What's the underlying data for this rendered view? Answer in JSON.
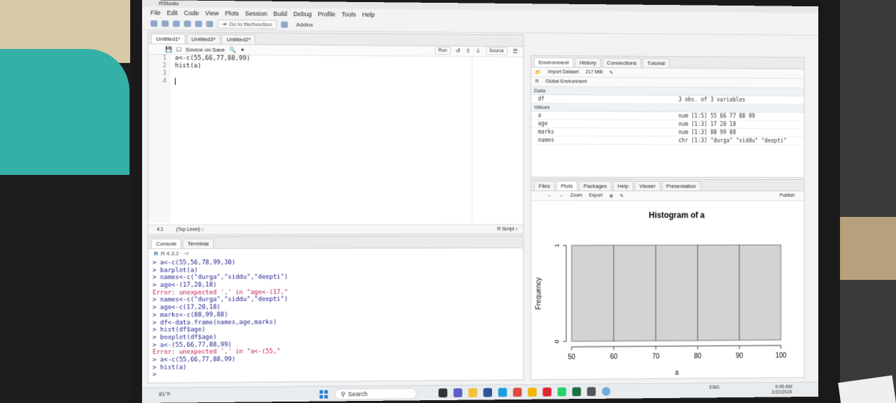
{
  "app": {
    "title": "RStudio"
  },
  "menu": [
    "File",
    "Edit",
    "Code",
    "View",
    "Plots",
    "Session",
    "Build",
    "Debug",
    "Profile",
    "Tools",
    "Help"
  ],
  "toolbar": {
    "goto_label": "Go to file/function",
    "addins_label": "Addins"
  },
  "source": {
    "tabs": [
      "Untitled1*",
      "Untitled3*",
      "Untitled2*"
    ],
    "source_on_save": "Source on Save",
    "run_label": "Run",
    "source_label": "Source",
    "lines": [
      {
        "n": "1",
        "text": "a<-c(55,66,77,88,99)"
      },
      {
        "n": "2",
        "text": "hist(a)"
      },
      {
        "n": "3",
        "text": ""
      },
      {
        "n": "4",
        "text": ""
      }
    ],
    "status_pos": "4:1",
    "status_scope": "(Top Level) ↕",
    "status_type": "R Script ↕"
  },
  "console": {
    "tabs": [
      "Console",
      "Terminal"
    ],
    "version": "R 4.3.2 · ~/",
    "lines": [
      {
        "text": "> a<-c(55,56,78,99,30)",
        "err": false
      },
      {
        "text": "> barplot(a)",
        "err": false
      },
      {
        "text": "> names<-c(\"durga\",\"siddu\",\"deepti\")",
        "err": false
      },
      {
        "text": "> age<-(17,20,18)",
        "err": false
      },
      {
        "text": "Error: unexpected ',' in \"age<-(17,\"",
        "err": true
      },
      {
        "text": "> names<-c(\"durga\",\"siddu\",\"deepti\")",
        "err": false
      },
      {
        "text": "> age<-c(17,20,18)",
        "err": false
      },
      {
        "text": "> marks<-c(88,99,88)",
        "err": false
      },
      {
        "text": "> df<-data.frame(names,age,marks)",
        "err": false
      },
      {
        "text": "> hist(df$age)",
        "err": false
      },
      {
        "text": "> boxplot(df$age)",
        "err": false
      },
      {
        "text": "> a<-(55,66,77,88,99)",
        "err": false
      },
      {
        "text": "Error: unexpected ',' in \"a<-(55,\"",
        "err": true
      },
      {
        "text": "> a<-c(55,66,77,88,99)",
        "err": false
      },
      {
        "text": "> hist(a)",
        "err": false
      },
      {
        "text": "> ",
        "err": false
      }
    ]
  },
  "environment": {
    "tabs": [
      "Environment",
      "History",
      "Connections",
      "Tutorial"
    ],
    "import_label": "Import Dataset",
    "memory": "217 MiB",
    "lang": "R",
    "scope": "Global Environment",
    "data_header": "Data",
    "values_header": "Values",
    "data_rows": [
      {
        "name": "df",
        "value": "3 obs. of 3 variables"
      }
    ],
    "value_rows": [
      {
        "name": "a",
        "value": "num [1:5] 55 66 77 88 99"
      },
      {
        "name": "age",
        "value": "num [1:3] 17 20 18"
      },
      {
        "name": "marks",
        "value": "num [1:3] 88 99 88"
      },
      {
        "name": "names",
        "value": "chr [1:3] \"durga\" \"siddu\" \"deepti\""
      }
    ]
  },
  "plots": {
    "tabs": [
      "Files",
      "Plots",
      "Packages",
      "Help",
      "Viewer",
      "Presentation"
    ],
    "zoom_label": "Zoom",
    "export_label": "Export",
    "publish_label": "Publish"
  },
  "chart_data": {
    "type": "bar",
    "title": "Histogram of a",
    "xlabel": "a",
    "ylabel": "Frequency",
    "bins": [
      [
        50,
        60
      ],
      [
        60,
        70
      ],
      [
        70,
        80
      ],
      [
        80,
        90
      ],
      [
        90,
        100
      ]
    ],
    "values": [
      1,
      1,
      1,
      1,
      1
    ],
    "x_ticks": [
      "50",
      "60",
      "70",
      "80",
      "90",
      "100"
    ],
    "y_ticks": [
      "0",
      "1"
    ],
    "xlim": [
      50,
      100
    ],
    "ylim": [
      0,
      1
    ],
    "bar_color": "#d3d3d3"
  },
  "taskbar": {
    "temperature": "81°F",
    "search_label": "Search",
    "language": "ENG",
    "time": "9:45 AM",
    "date": "2/22/2024"
  }
}
